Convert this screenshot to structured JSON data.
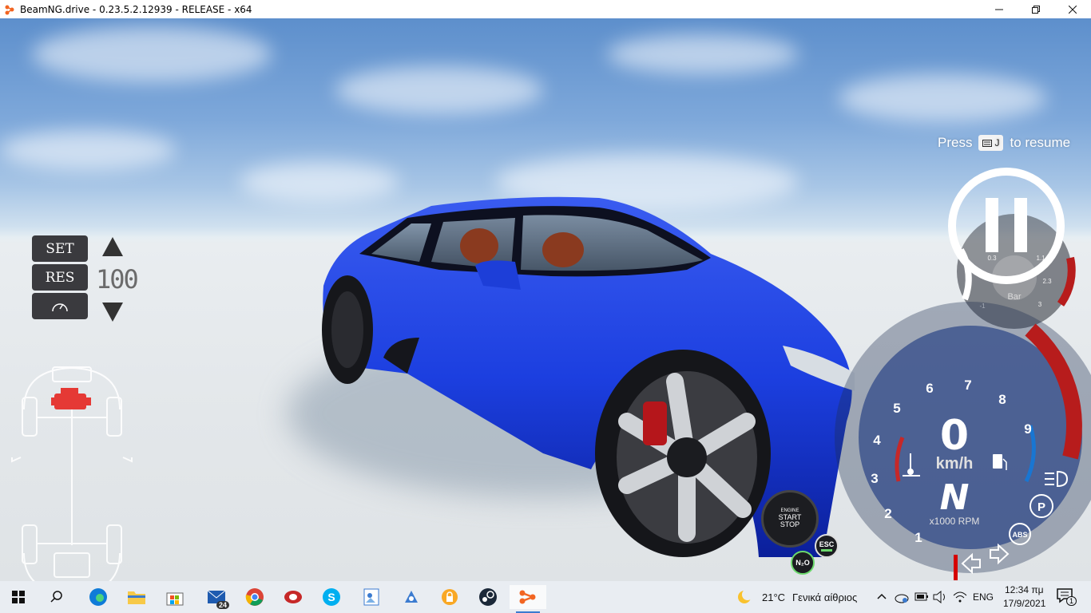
{
  "window": {
    "title": "BeamNG.drive - 0.23.5.2.12939 - RELEASE - x64",
    "minimize_icon": "minimize-icon",
    "maximize_icon": "restore-icon",
    "close_icon": "close-icon"
  },
  "hud": {
    "resume": {
      "press": "Press",
      "key": "J",
      "suffix": "to resume"
    },
    "cruise_control": {
      "set_label": "SET",
      "res_label": "RES",
      "speed": "100"
    },
    "boost_gauge": {
      "unit": "Bar",
      "ticks": [
        "-1",
        "0.3",
        "1.1",
        "2.3",
        "3"
      ],
      "value": "0"
    },
    "speedometer": {
      "speed": "0",
      "speed_unit": "km/h",
      "gear": "N",
      "rpm_label": "x1000 RPM",
      "rpm_ticks": [
        "1",
        "2",
        "3",
        "4",
        "5",
        "6",
        "7",
        "8",
        "9"
      ],
      "abs_label": "ABS",
      "park_label": "P"
    },
    "engine_button": {
      "line1": "ENGINE",
      "line2": "START",
      "line3": "STOP"
    },
    "esc_label": "ESC",
    "nos_label": "N₂O"
  },
  "taskbar": {
    "apps": [
      {
        "name": "start-button"
      },
      {
        "name": "search-button"
      },
      {
        "name": "edge-app"
      },
      {
        "name": "file-explorer-app"
      },
      {
        "name": "store-app"
      },
      {
        "name": "mail-app",
        "badge": "24"
      },
      {
        "name": "chrome-app"
      },
      {
        "name": "red-app"
      },
      {
        "name": "skype-app"
      },
      {
        "name": "paint-app"
      },
      {
        "name": "settings-app"
      },
      {
        "name": "vpn-app"
      },
      {
        "name": "steam-app"
      },
      {
        "name": "beamng-app"
      }
    ],
    "weather": {
      "temp": "21°C",
      "condition": "Γενικά αίθριος"
    },
    "language": "ENG",
    "time": "12:34 πμ",
    "date": "17/9/2021",
    "notification_count": "1"
  }
}
